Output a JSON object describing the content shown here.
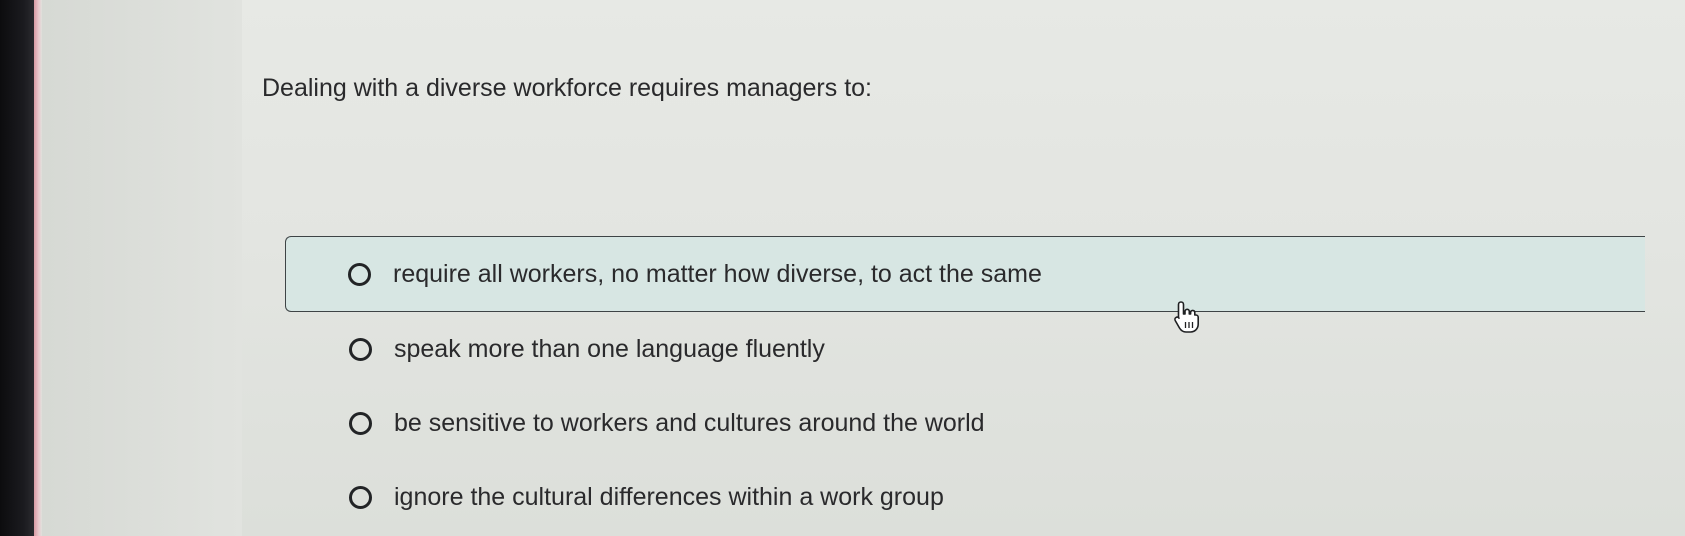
{
  "question": {
    "text": "Dealing with a diverse workforce requires managers to:"
  },
  "options": [
    {
      "label": "require all workers, no matter how diverse, to act the same",
      "selected": false,
      "highlighted": true
    },
    {
      "label": "speak more than one language fluently",
      "selected": false,
      "highlighted": false
    },
    {
      "label": "be sensitive to workers and cultures around the world",
      "selected": false,
      "highlighted": false
    },
    {
      "label": "ignore the cultural differences within a work group",
      "selected": false,
      "highlighted": false
    }
  ],
  "cursor": {
    "icon": "hand-pointer-icon"
  },
  "colors": {
    "highlight_background": "#d7e6e3",
    "text": "#2a2a2c",
    "radio_border": "#222426"
  }
}
